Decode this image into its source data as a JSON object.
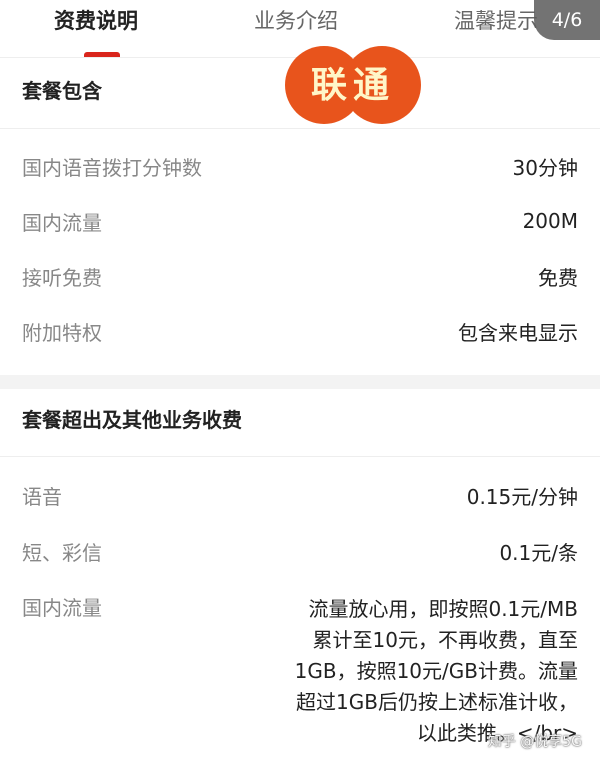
{
  "tabs": [
    "资费说明",
    "业务介绍",
    "温馨提示"
  ],
  "pager": "4/6",
  "logo_text": "联通",
  "package": {
    "title": "套餐包含",
    "rows": [
      {
        "label": "国内语音拨打分钟数",
        "value": "30分钟"
      },
      {
        "label": "国内流量",
        "value": "200M"
      },
      {
        "label": "接听免费",
        "value": "免费"
      },
      {
        "label": "附加特权",
        "value": "包含来电显示"
      }
    ]
  },
  "overage": {
    "title": "套餐超出及其他业务收费",
    "rows": [
      {
        "label": "语音",
        "value": "0.15元/分钟"
      },
      {
        "label": "短、彩信",
        "value": "0.1元/条"
      }
    ],
    "data_label": "国内流量",
    "data_lines": [
      "流量放心用，即按照0.1元/MB",
      "累计至10元，不再收费，直至",
      "1GB，按照10元/GB计费。流量",
      "超过1GB后仍按上述标准计收，",
      "以此类推。</br>"
    ]
  },
  "watermark": "知乎 @悦享5G",
  "colors": {
    "accent": "#d9251c",
    "logo": "#e8541c"
  }
}
